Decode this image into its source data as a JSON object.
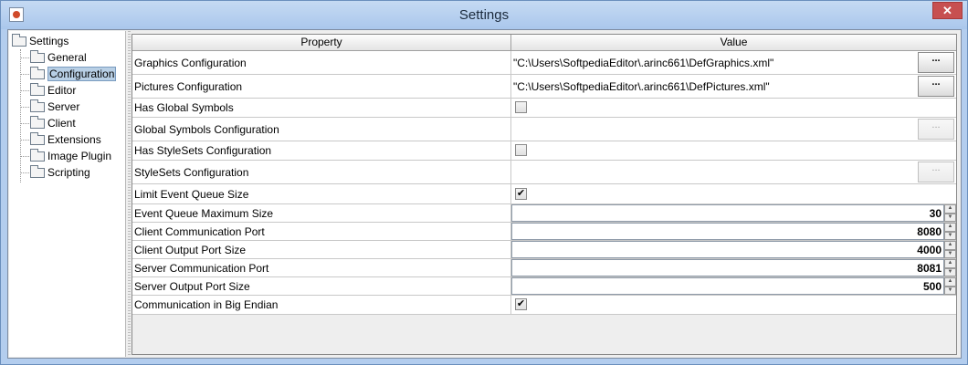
{
  "window": {
    "title": "Settings",
    "close_label": "✕"
  },
  "tree": {
    "root": "Settings",
    "items": [
      {
        "label": "General"
      },
      {
        "label": "Configuration"
      },
      {
        "label": "Editor"
      },
      {
        "label": "Server"
      },
      {
        "label": "Client"
      },
      {
        "label": "Extensions"
      },
      {
        "label": "Image Plugin"
      },
      {
        "label": "Scripting"
      }
    ]
  },
  "table": {
    "columns": [
      "Property",
      "Value"
    ],
    "rows": [
      {
        "property": "Graphics Configuration",
        "value": "\"C:\\Users\\SoftpediaEditor\\.arinc661\\DefGraphics.xml\"",
        "button": "..."
      },
      {
        "property": "Pictures Configuration",
        "value": "\"C:\\Users\\SoftpediaEditor\\.arinc661\\DefPictures.xml\"",
        "button": "..."
      },
      {
        "property": "Has Global Symbols",
        "checked": ""
      },
      {
        "property": "Global Symbols Configuration",
        "value": "",
        "button": "..."
      },
      {
        "property": "Has StyleSets Configuration",
        "checked": ""
      },
      {
        "property": "StyleSets Configuration",
        "value": "",
        "button": "..."
      },
      {
        "property": "Limit Event Queue Size",
        "checked": "✔"
      },
      {
        "property": "Event Queue Maximum Size",
        "number": "30"
      },
      {
        "property": "Client Communication Port",
        "number": "8080"
      },
      {
        "property": "Client Output Port Size",
        "number": "4000"
      },
      {
        "property": "Server Communication Port",
        "number": "8081"
      },
      {
        "property": "Server Output Port Size",
        "number": "500"
      },
      {
        "property": "Communication in Big Endian",
        "checked": "✔"
      }
    ]
  }
}
